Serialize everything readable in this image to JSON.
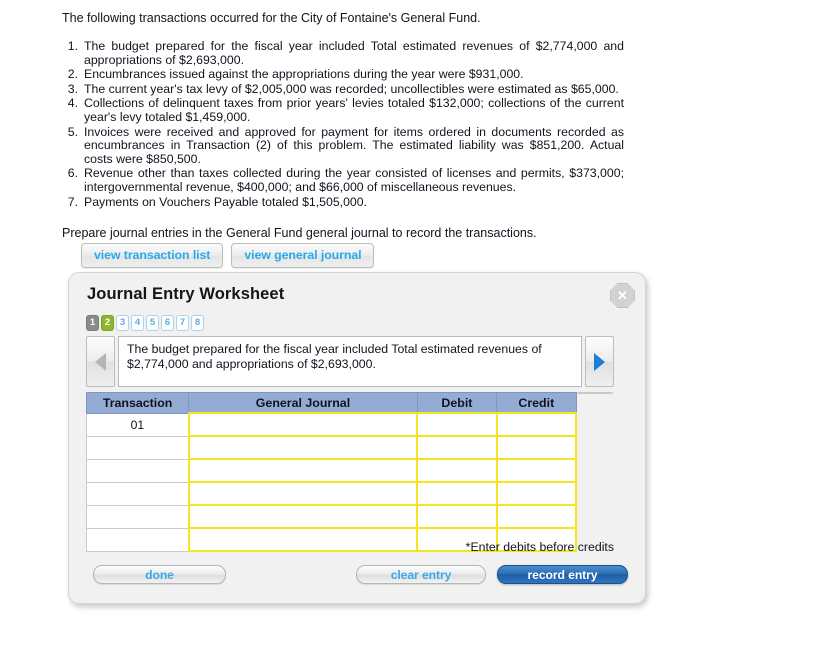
{
  "problem": {
    "intro": "The following transactions occurred for the City of Fontaine's General Fund.",
    "transactions": [
      {
        "num": "1.",
        "text": "The budget prepared for the fiscal year included Total estimated revenues of $2,774,000 and appropriations of $2,693,000."
      },
      {
        "num": "2.",
        "text": "Encumbrances issued against the appropriations during the year were $931,000."
      },
      {
        "num": "3.",
        "text": "The current year's tax levy of $2,005,000 was recorded; uncollectibles were estimated as $65,000."
      },
      {
        "num": "4.",
        "text": "Collections of delinquent taxes from prior years' levies totaled $132,000; collections of the current year's levy totaled $1,459,000."
      },
      {
        "num": "5.",
        "text": "Invoices were received and approved for payment for items ordered in documents recorded as encumbrances in Transaction (2) of this problem. The estimated liability was $851,200. Actual costs were $850,500."
      },
      {
        "num": "6.",
        "text": "Revenue other than taxes collected during the year consisted of licenses and permits, $373,000; intergovernmental revenue, $400,000; and $66,000 of miscellaneous revenues."
      },
      {
        "num": "7.",
        "text": "Payments on Vouchers Payable totaled $1,505,000."
      }
    ],
    "prepare": "Prepare journal entries in the General Fund general journal to record the transactions."
  },
  "view_tabs": [
    {
      "label": "view transaction list"
    },
    {
      "label": "view general journal"
    }
  ],
  "worksheet": {
    "title": "Journal Entry Worksheet",
    "close_icon": "✕",
    "steps": [
      {
        "label": "1",
        "state": "done"
      },
      {
        "label": "2",
        "state": "active"
      },
      {
        "label": "3",
        "state": "todo"
      },
      {
        "label": "4",
        "state": "todo"
      },
      {
        "label": "5",
        "state": "todo"
      },
      {
        "label": "6",
        "state": "todo"
      },
      {
        "label": "7",
        "state": "todo"
      },
      {
        "label": "8",
        "state": "todo"
      }
    ],
    "prev_enabled": false,
    "next_enabled": true,
    "description": "The budget prepared for the fiscal year included Total estimated revenues of $2,774,000 and appropriations of $2,693,000.",
    "table": {
      "headers": [
        "Transaction",
        "General Journal",
        "Debit",
        "Credit"
      ],
      "rows": [
        {
          "transaction": "01",
          "general_journal": "",
          "debit": "",
          "credit": ""
        },
        {
          "transaction": "",
          "general_journal": "",
          "debit": "",
          "credit": ""
        },
        {
          "transaction": "",
          "general_journal": "",
          "debit": "",
          "credit": ""
        },
        {
          "transaction": "",
          "general_journal": "",
          "debit": "",
          "credit": ""
        },
        {
          "transaction": "",
          "general_journal": "",
          "debit": "",
          "credit": ""
        },
        {
          "transaction": "",
          "general_journal": "",
          "debit": "",
          "credit": ""
        }
      ]
    },
    "hint": "*Enter debits before credits",
    "buttons": {
      "done": "done",
      "clear_entry": "clear entry",
      "record_entry": "record entry"
    }
  },
  "colors": {
    "tab_text": "#2aa9e8",
    "step_done": "#8b8b8b",
    "step_active": "#8cb62c",
    "step_todo_text": "#5aade4",
    "table_header_bg": "#94acd4",
    "input_border": "#f4e61c",
    "record_entry_bg": "#2f6fb5",
    "next_arrow": "#1b7fd4"
  }
}
